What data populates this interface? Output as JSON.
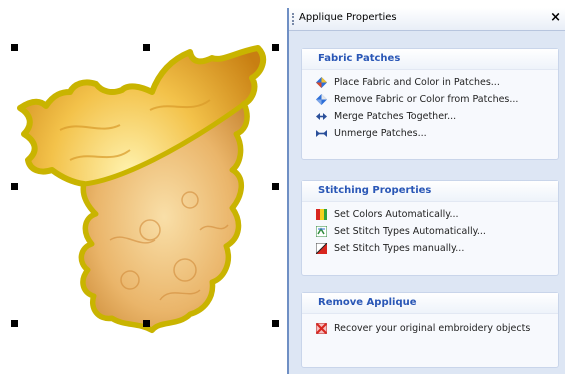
{
  "panel": {
    "title": "Applique Properties",
    "close_glyph": "×"
  },
  "groups": [
    {
      "heading": "Fabric Patches",
      "items": [
        {
          "label": "Place Fabric and Color in Patches...",
          "icon": "place-fabric-icon"
        },
        {
          "label": "Remove Fabric or Color from Patches...",
          "icon": "remove-fabric-icon"
        },
        {
          "label": "Merge Patches Together...",
          "icon": "merge-patches-icon"
        },
        {
          "label": "Unmerge Patches...",
          "icon": "unmerge-patches-icon"
        }
      ]
    },
    {
      "heading": "Stitching Properties",
      "items": [
        {
          "label": "Set Colors Automatically...",
          "icon": "set-colors-icon"
        },
        {
          "label": "Set Stitch Types Automatically...",
          "icon": "set-stitch-auto-icon"
        },
        {
          "label": "Set Stitch Types manually...",
          "icon": "set-stitch-manual-icon"
        }
      ]
    },
    {
      "heading": "Remove Applique",
      "items": [
        {
          "label": "Recover your original embroidery objects",
          "icon": "recover-icon"
        }
      ]
    }
  ],
  "colors": {
    "accent": "#2a57b6",
    "panel_bg": "#dde6f4",
    "leaf_edge": "#c9b400",
    "leaf_fill": "#e8b24a"
  }
}
